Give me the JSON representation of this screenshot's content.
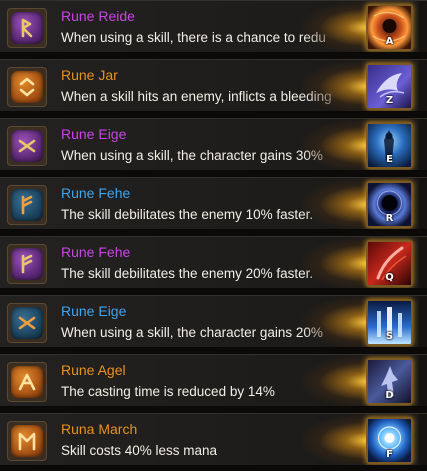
{
  "runes": [
    {
      "name": "Rune Reide",
      "description": "When using a skill, there is a chance to redu",
      "rarity_color": "#c944e8",
      "rune_icon": "rune-reide-icon",
      "skill_icon": "fire-vortex-skill-icon",
      "hotkey": "A"
    },
    {
      "name": "Rune Jar",
      "description": "When a skill hits an enemy, inflicts a bleeding",
      "rarity_color": "#e8921e",
      "rune_icon": "rune-jar-icon",
      "skill_icon": "wind-spirit-skill-icon",
      "hotkey": "Z"
    },
    {
      "name": "Rune Eige",
      "description": "When using a skill, the character gains 30%",
      "rarity_color": "#c944e8",
      "rune_icon": "rune-eige-icon",
      "skill_icon": "guardian-skill-icon",
      "hotkey": "E"
    },
    {
      "name": "Rune Fehe",
      "description": "The skill debilitates the enemy 10% faster.",
      "rarity_color": "#3fa4ee",
      "rune_icon": "rune-fehe-icon",
      "skill_icon": "dark-orb-skill-icon",
      "hotkey": "R"
    },
    {
      "name": "Rune Fehe",
      "description": "The skill debilitates the enemy 20% faster.",
      "rarity_color": "#c944e8",
      "rune_icon": "rune-fehe-icon",
      "skill_icon": "blood-slash-skill-icon",
      "hotkey": "Q"
    },
    {
      "name": "Rune Eige",
      "description": "When using a skill, the character gains 20%",
      "rarity_color": "#3fa4ee",
      "rune_icon": "rune-eige-icon",
      "skill_icon": "frost-pillars-skill-icon",
      "hotkey": "S"
    },
    {
      "name": "Rune Agel",
      "description": "The casting time is reduced by 14%",
      "rarity_color": "#e8921e",
      "rune_icon": "rune-agel-icon",
      "skill_icon": "shadow-dancer-skill-icon",
      "hotkey": "D"
    },
    {
      "name": "Runa March",
      "description": "Skill costs 40% less mana",
      "rarity_color": "#e8921e",
      "rune_icon": "rune-march-icon",
      "skill_icon": "mana-burst-skill-icon",
      "hotkey": "F"
    }
  ],
  "colors": {
    "legendary": "#e8921e",
    "epic": "#c944e8",
    "rare": "#3fa4ee",
    "description_text": "#f2efe9",
    "row_background": "#221f1c"
  }
}
